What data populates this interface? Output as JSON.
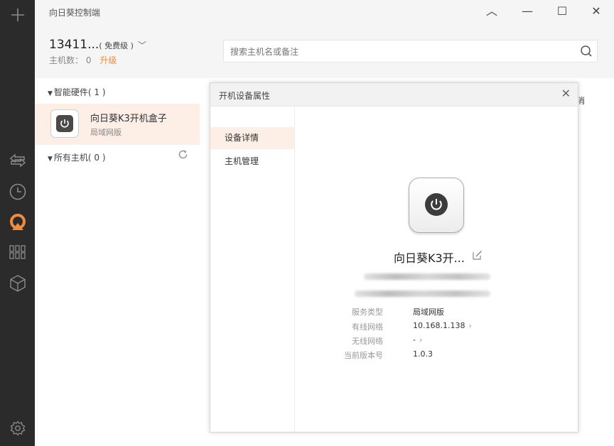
{
  "app": {
    "title": "向日葵控制端"
  },
  "window_controls": {
    "up": "︿",
    "minimize": "—",
    "maximize": "☐",
    "close": "✕"
  },
  "account": {
    "name": "13411...",
    "tier": "( 免费级 )",
    "hosts_label": "主机数：",
    "hosts_count": "0",
    "upgrade": "升级"
  },
  "search": {
    "placeholder": "搜索主机名或备注"
  },
  "sidebar": {
    "icons": [
      "plus-icon",
      "remote-control-icon",
      "history-icon",
      "sunflower-logo-icon",
      "apps-grid-icon",
      "package-icon",
      "settings-icon"
    ]
  },
  "groups": [
    {
      "label": "智能硬件( 1 )"
    },
    {
      "label": "所有主机( 0 )"
    }
  ],
  "device": {
    "name": "向日葵K3开机盒子",
    "network": "局域网版"
  },
  "peek_text": "消",
  "dialog": {
    "title": "开机设备属性",
    "nav": [
      {
        "label": "设备详情"
      },
      {
        "label": "主机管理"
      }
    ],
    "device_title": "向日葵K3开...",
    "props": [
      {
        "label": "服务类型",
        "value": "局域网版",
        "arrow": ""
      },
      {
        "label": "有线网络",
        "value": "10.168.1.138",
        "arrow": "›"
      },
      {
        "label": "无线网络",
        "value": "-",
        "arrow": "›"
      },
      {
        "label": "当前版本号",
        "value": "1.0.3",
        "arrow": ""
      }
    ]
  },
  "colors": {
    "accent": "#f08c3c",
    "rail": "#2b2b2b",
    "selected": "#fdeee6"
  }
}
